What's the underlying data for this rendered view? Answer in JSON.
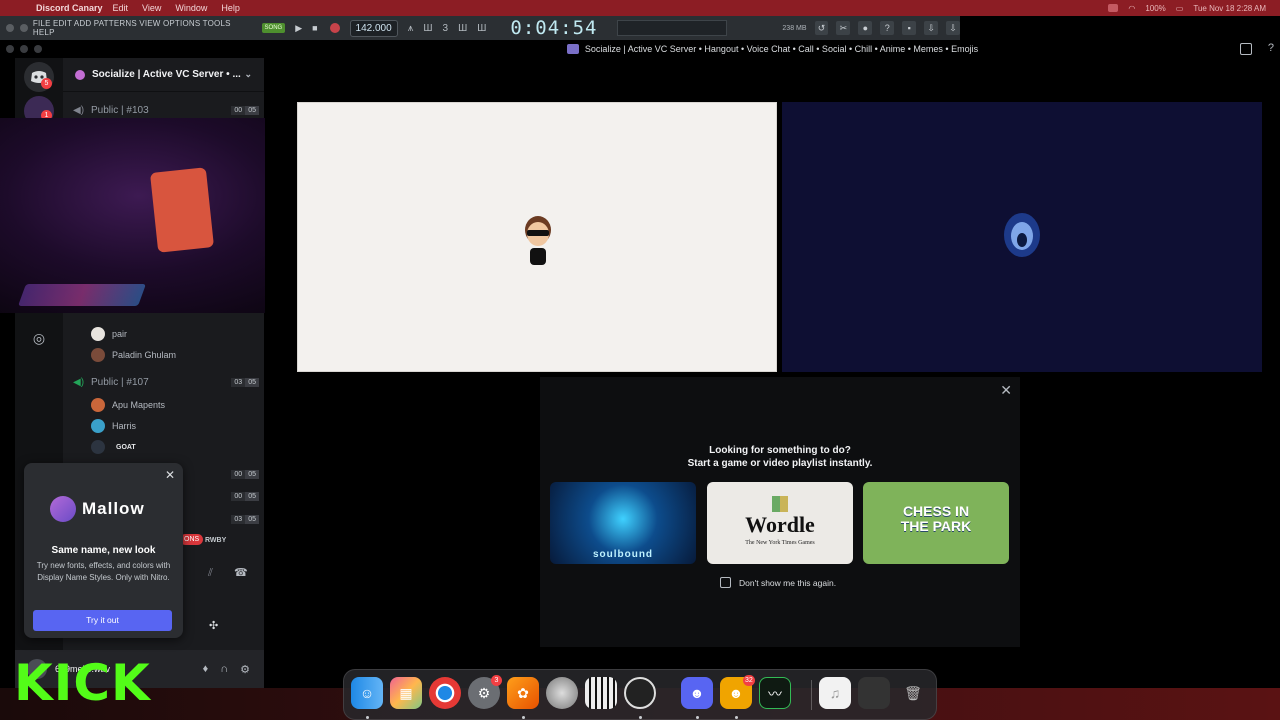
{
  "menubar": {
    "app_name": "Discord Canary",
    "items": [
      "Edit",
      "View",
      "Window",
      "Help"
    ],
    "clock": "Tue Nov 18  2:28 AM",
    "battery": "100%"
  },
  "fl": {
    "menu": "FILE EDIT ADD PATTERNS VIEW OPTIONS TOOLS HELP",
    "song_label": "SONG",
    "bpm": "142.000",
    "time": "0:04:54",
    "mem": "238 MB"
  },
  "discord": {
    "window_title": "Socialize | Active VC Server • Hangout • Voice Chat • Call • Social • Chill • Anime • Memes • Emojis",
    "server_header": "Socialize | Active VC Server • ...",
    "rail_badges": {
      "dm": "5",
      "server": "1"
    },
    "channels": {
      "public_103": {
        "label": "Public | #103",
        "count_a": "00",
        "count_b": "05"
      },
      "public_107": {
        "label": "Public | #107",
        "count_a": "03",
        "count_b": "05"
      },
      "ch_a": {
        "count_a": "00",
        "count_b": "05"
      },
      "ch_b": {
        "count_a": "00",
        "count_b": "05"
      },
      "ch_c": {
        "count_a": "03",
        "count_b": "05"
      }
    },
    "users": {
      "pair": "pair",
      "paladin": "Paladin Ghulam",
      "apu": "Apu Mapents",
      "harris": "Harris",
      "goat_tag": "GOAT"
    },
    "tags": {
      "red": "ONS",
      "text": "RWBY"
    },
    "user_panel": {
      "name": "629mello.wav"
    },
    "mallow": {
      "brand": "Mallow",
      "heading": "Same name, new look",
      "body": "Try new fonts, effects, and colors with Display Name Styles. Only with Nitro.",
      "button": "Try it out"
    },
    "activity": {
      "line1": "Looking for something to do?",
      "line2": "Start a game or video playlist instantly.",
      "cards": {
        "soulbound": "soulbound",
        "wordle": "Wordle",
        "wordle_sub": "The New York Times Games",
        "chess": "CHESS IN THE PARK"
      },
      "checkbox_label": "Don't show me this again."
    }
  },
  "dock": {
    "badges": {
      "settings": "3",
      "discord": "32"
    }
  },
  "overlay": {
    "kick": "KICK"
  },
  "colors": {
    "discord_blurple": "#5865f2",
    "kick_green": "#53fc18",
    "menubar_red": "#8c1d24"
  }
}
